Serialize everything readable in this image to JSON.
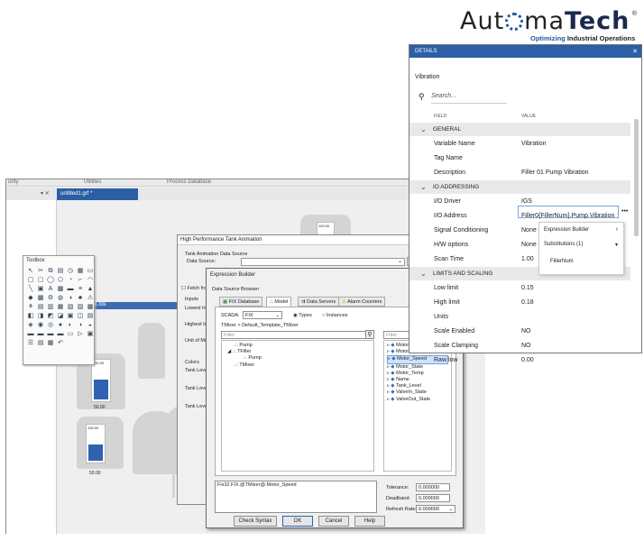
{
  "logo": {
    "pre": "Aut",
    "post": "ma",
    "bold": "Tech",
    "reg": "®",
    "tag_a": "Optimizing",
    "tag_b": "Industrial Operations"
  },
  "app": {
    "menu": [
      "urity",
      "Utilities",
      "Process Database"
    ],
    "doc_tab": "untitled1.grf *",
    "doc_tab2": "rrk.fds",
    "close_glyphs": "▾ ✕",
    "tank_labels": [
      "100.00",
      "100.00",
      "50.00",
      "50.00",
      "100.00"
    ]
  },
  "toolbox": {
    "title": "Toolbox"
  },
  "tank_dialog": {
    "title": "High Performance Tank Animation",
    "section": "Tank Animation Data Source",
    "data_source": "Data Source:",
    "fetch": "Fetch fro",
    "inputs": "Inputs",
    "lowest": "Lowest Inp",
    "highest": "Highest Inp",
    "unit": "Unit of Mea",
    "colors": "Colors",
    "tank_level": [
      "Tank Leve",
      "Tank Leve",
      "Tank Leve"
    ]
  },
  "expr": {
    "title": "Expression Builder",
    "browser": "Data Source Browser",
    "tabs": [
      "FIX Database",
      "Model",
      "Data Servers",
      "Alarm Counters"
    ],
    "scada_label": "SCADA:",
    "scada_value": "FIX",
    "types": "Types",
    "instances": "Instances",
    "path": "TMixer > Default_Template_TMixer",
    "filter": "Filter",
    "left_tree": [
      "Pump",
      "TFiller",
      "Pump",
      "TMixer"
    ],
    "right_tree": [
      "Motor_",
      "Motor_",
      "Motor_Speed",
      "Motor_State",
      "Motor_Temp",
      "Name",
      "Tank_Level",
      "ValveIn_State",
      "ValveOut_State"
    ],
    "expression": "Fix32.FIX.@TMixer@.Motor_Speed",
    "tolerance_label": "Tolerance:",
    "tolerance": "0.000000",
    "deadband_label": "Deadband:",
    "deadband": "0.000000",
    "refresh_label": "Refresh Rate:",
    "refresh": "0.000000",
    "buttons": {
      "check": "Check Syntax",
      "ok": "OK",
      "cancel": "Cancel",
      "help": "Help"
    }
  },
  "details": {
    "header": "DETAILS",
    "close": "✕",
    "title": "Vibration",
    "search_placeholder": "Search...",
    "col_field": "FIELD",
    "col_value": "VALUE",
    "rows": [
      {
        "type": "section",
        "field": "GENERAL"
      },
      {
        "field": "Variable Name",
        "value": "Vibration"
      },
      {
        "field": "Tag Name",
        "value": ""
      },
      {
        "field": "Description",
        "value": "Filler 01 Pump Vibration"
      },
      {
        "type": "section",
        "field": "IO ADDRESSING"
      },
      {
        "field": "I/O Driver",
        "value": "IGS"
      },
      {
        "field": "I/O Address",
        "value": "Filler0{FillerNum}.Pump.Vibration"
      },
      {
        "field": "Signal Conditioning",
        "value": "None"
      },
      {
        "field": "H/W options",
        "value": "None"
      },
      {
        "field": "Scan Time",
        "value": "1.00"
      },
      {
        "type": "section",
        "field": "LIMITS AND SCALING"
      },
      {
        "field": "Low limit",
        "value": "0.15"
      },
      {
        "field": "High limit",
        "value": "0.18"
      },
      {
        "field": "Units",
        "value": ""
      },
      {
        "field": "Scale Enabled",
        "value": "NO"
      },
      {
        "field": "Scale Clamping",
        "value": "NO"
      },
      {
        "field": "Raw low",
        "value": "0.00"
      }
    ],
    "more": "•••"
  },
  "popup": {
    "expression_builder": "Expression Builder",
    "substitutions": "Substitutions (1)",
    "item": "FillerNum"
  },
  "colors": {
    "accent": "#2b5fa8",
    "tank_fill": "#2f62b0"
  }
}
